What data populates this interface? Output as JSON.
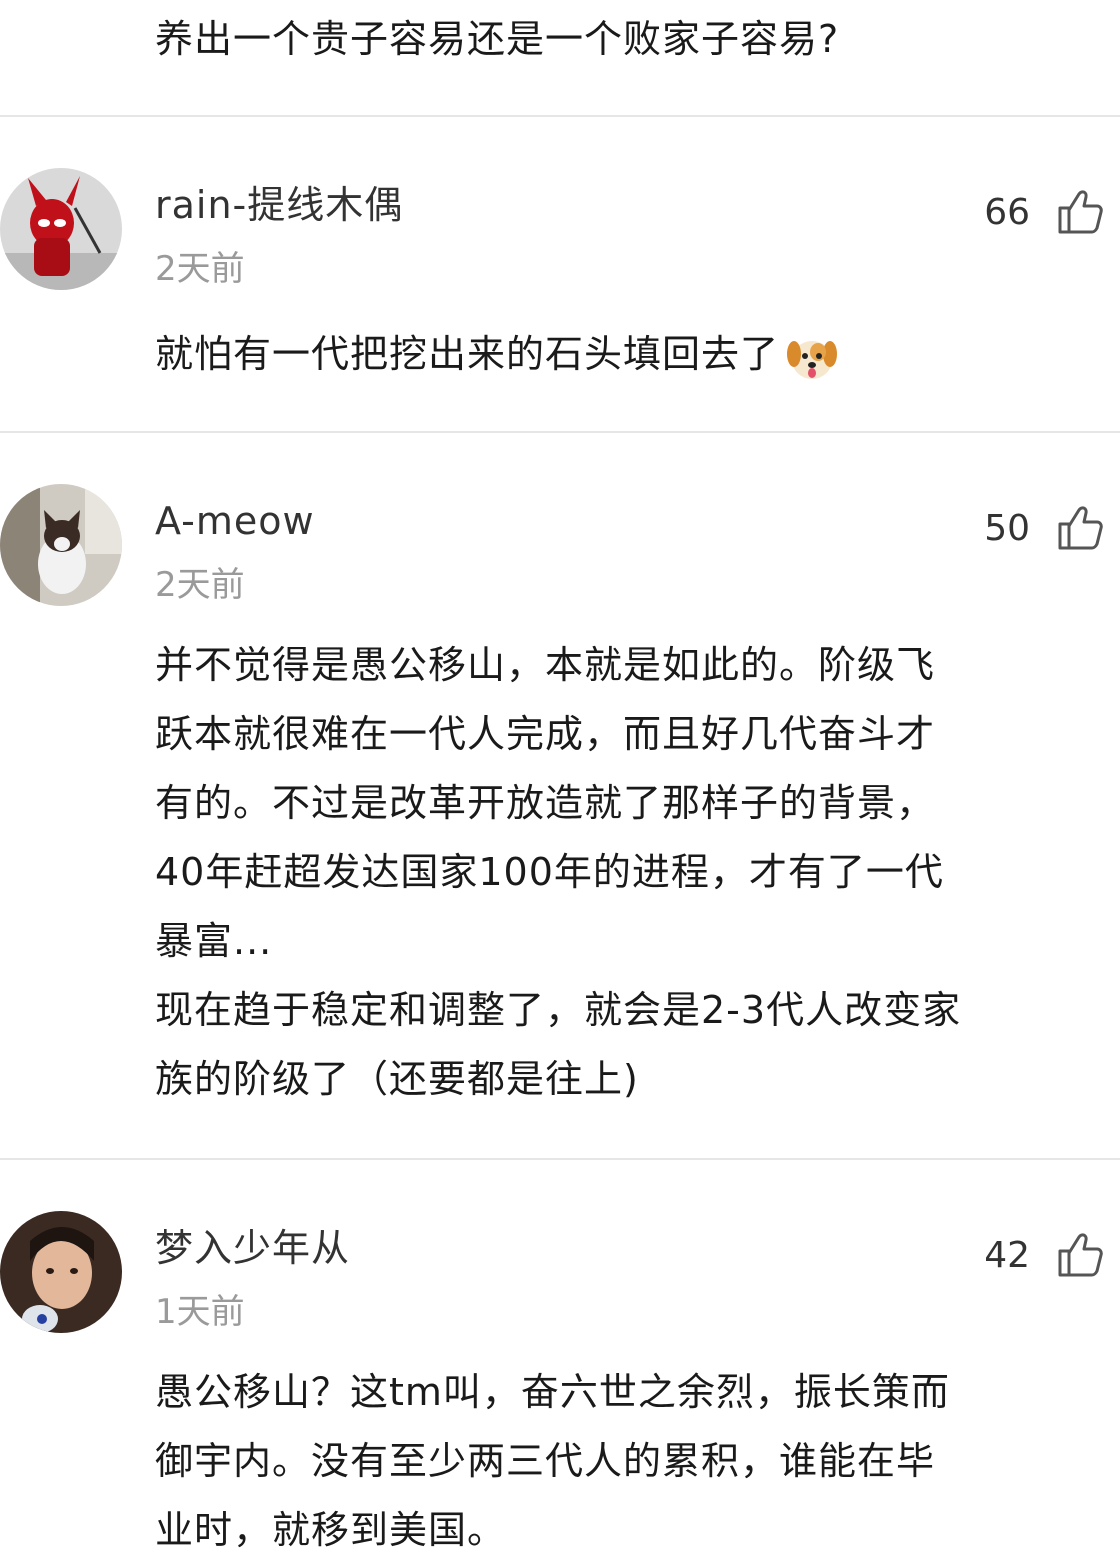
{
  "top": {
    "text": "养出一个贵子容易还是一个败家子容易?"
  },
  "comments": [
    {
      "username": "rain-提线木偶",
      "time": "2天前",
      "likes": "66",
      "text_lines": [
        "就怕有一代把挖出来的石头填回去了"
      ],
      "emoji": "dog-emoji"
    },
    {
      "username": "A-meow",
      "time": "2天前",
      "likes": "50",
      "text_lines": [
        "并不觉得是愚公移山，本就是如此的。阶级飞",
        "跃本就很难在一代人完成，而且好几代奋斗才",
        "有的。不过是改革开放造就了那样子的背景，",
        "40年赶超发达国家100年的进程，才有了一代",
        "暴富...",
        "现在趋于稳定和调整了，就会是2-3代人改变家",
        "族的阶级了（还要都是往上)"
      ]
    },
    {
      "username": "梦入少年从",
      "time": "1天前",
      "likes": "42",
      "text_lines": [
        "愚公移山？这tm叫，奋六世之余烈，振长策而",
        "御宇内。没有至少两三代人的累积，谁能在毕",
        "业时，就移到美国。"
      ]
    }
  ],
  "colors": {
    "text": "#1a1a1a",
    "secondary": "#9a9a9a",
    "divider": "#e6e6e6"
  },
  "icons": {
    "like": "thumbs-up-icon"
  }
}
